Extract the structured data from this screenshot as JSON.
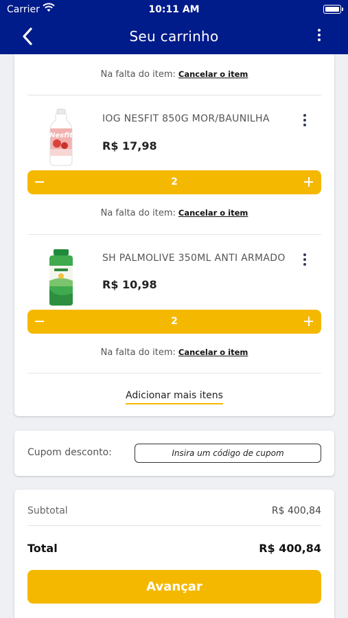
{
  "status_bar": {
    "carrier": "Carrier",
    "time": "10:11 AM"
  },
  "nav": {
    "title": "Seu carrinho"
  },
  "cart": {
    "missing_label": "Na falta do item:",
    "cancel_link": "Cancelar o item",
    "items": [
      {
        "name": "IOG NESFIT 850G MOR/BAUNILHA",
        "price": "R$ 17,98",
        "quantity": "2",
        "brand": "Nesfit"
      },
      {
        "name": "SH PALMOLIVE 350ML ANTI ARMADO",
        "price": "R$ 10,98",
        "quantity": "2"
      }
    ],
    "add_more": "Adicionar mais itens"
  },
  "coupon": {
    "label": "Cupom desconto:",
    "placeholder": "Insira um código de cupom"
  },
  "summary": {
    "subtotal_label": "Subtotal",
    "subtotal_value": "R$ 400,84",
    "total_label": "Total",
    "total_value": "R$ 400,84",
    "advance_label": "Avançar"
  },
  "colors": {
    "header": "#001b8a",
    "accent": "#f5b800"
  }
}
